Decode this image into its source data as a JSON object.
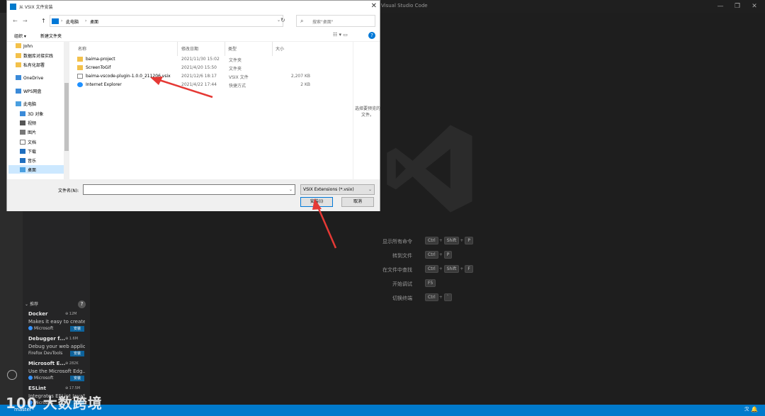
{
  "colors": {
    "accent": "#007acc",
    "annotation": "#e53935"
  },
  "vscode": {
    "window_title": "Visual Studio Code",
    "controls": {
      "minimize": "—",
      "maximize": "❐",
      "close": "✕"
    },
    "shortcuts": [
      {
        "label": "显示所有命令",
        "keys": [
          "Ctrl",
          "Shift",
          "P"
        ]
      },
      {
        "label": "转到文件",
        "keys": [
          "Ctrl",
          "P"
        ]
      },
      {
        "label": "在文件中查找",
        "keys": [
          "Ctrl",
          "Shift",
          "F"
        ]
      },
      {
        "label": "开始调试",
        "keys": [
          "F5"
        ]
      },
      {
        "label": "切换终端",
        "keys": [
          "Ctrl",
          "`"
        ]
      }
    ],
    "extensions_header": "推荐",
    "extensions_help": "?",
    "extensions": [
      {
        "name": "Docker",
        "downloads": "12M",
        "desc": "Makes it easy to create...",
        "publisher": "Microsoft",
        "install": "安装"
      },
      {
        "name": "Debugger f...",
        "downloads": "1.6M",
        "desc": "Debug your web applic...",
        "publisher": "Firefox DevTools",
        "install": "安装"
      },
      {
        "name": "Microsoft E...",
        "downloads": "282K",
        "desc": "Use the Microsoft Edg...",
        "publisher": "Microsoft",
        "install": "安装"
      },
      {
        "name": "ESLint",
        "downloads": "17.5M",
        "desc": "Integrates ESLint JavaS...",
        "publisher": "Microsoft",
        "install": "安装"
      }
    ],
    "status_branch": "master*",
    "status_right": "ℛ  🔔",
    "watermark": "100 大数跨境"
  },
  "dialog": {
    "title": "从 VSIX 文件安装",
    "close": "✕",
    "nav": {
      "back": "←",
      "forward": "→",
      "up": "↑"
    },
    "address": {
      "seg1": "此电脑",
      "seg2": "桌面",
      "sep": "›"
    },
    "search_placeholder": "搜索\"桌面\"",
    "toolbar": {
      "organize": "组织 ▾",
      "new_folder": "新建文件夹",
      "view": "☷ ▾   ▭",
      "help": "?"
    },
    "nav_items": [
      {
        "label": "John",
        "icon": "folder"
      },
      {
        "label": "数据库对接实践",
        "icon": "folder"
      },
      {
        "label": "私有化部署",
        "icon": "folder"
      },
      {
        "label": "OneDrive",
        "icon": "cloud"
      },
      {
        "label": "WPS网盘",
        "icon": "cloud"
      },
      {
        "label": "此电脑",
        "icon": "pc"
      },
      {
        "label": "3D 对象",
        "icon": "folder"
      },
      {
        "label": "视频",
        "icon": "folder"
      },
      {
        "label": "图片",
        "icon": "folder"
      },
      {
        "label": "文档",
        "icon": "folder"
      },
      {
        "label": "下载",
        "icon": "folder"
      },
      {
        "label": "音乐",
        "icon": "folder"
      },
      {
        "label": "桌面",
        "icon": "pc"
      }
    ],
    "columns": {
      "name": "名称",
      "date": "修改日期",
      "type": "类型",
      "size": "大小"
    },
    "files": [
      {
        "name": "baima-project",
        "date": "2021/11/30 15:02",
        "type": "文件夹",
        "size": "",
        "icon": "folder"
      },
      {
        "name": "ScreenToGif",
        "date": "2021/4/20 15:50",
        "type": "文件夹",
        "size": "",
        "icon": "folder"
      },
      {
        "name": "baima-vscode-plugin-1.0.0_211206.vsix",
        "date": "2021/12/6 18:17",
        "type": "VSIX 文件",
        "size": "2,207 KB",
        "icon": "file"
      },
      {
        "name": "Internet  Explorer",
        "date": "2021/4/22 17:44",
        "type": "快捷方式",
        "size": "2 KB",
        "icon": "ie"
      }
    ],
    "preview_text": "选择要预览的文件。",
    "filename_label": "文件名(N):",
    "filename_value": "",
    "filetype": "VSIX Extensions (*.vsix)",
    "install_button": "安装(I)",
    "cancel_button": "取消"
  }
}
